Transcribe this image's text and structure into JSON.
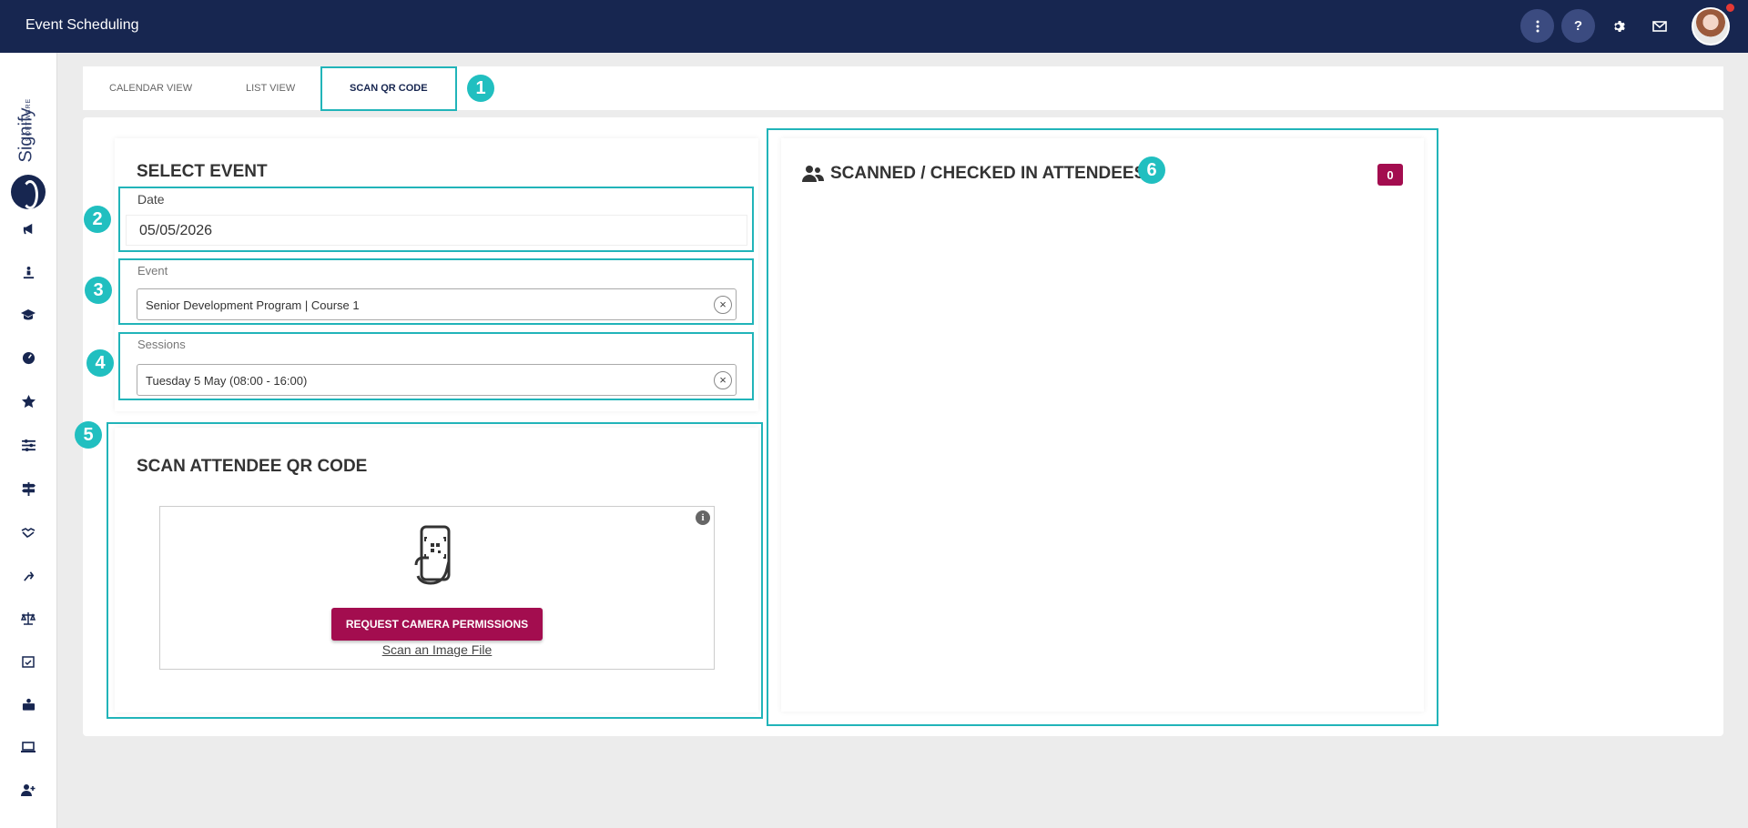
{
  "header": {
    "title": "Event Scheduling"
  },
  "topbar_icons": [
    "more-vert-icon",
    "help-icon",
    "gear-icon",
    "mail-icon",
    "avatar"
  ],
  "logo": {
    "word": "Signify",
    "sub": "SOFTWARE"
  },
  "sidebar": {
    "icons": [
      "megaphone-icon",
      "person-ramp-icon",
      "graduation-cap-icon",
      "gauge-icon",
      "star-icon",
      "sliders-icon",
      "signpost-icon",
      "handshake-icon",
      "route-icon",
      "scales-icon",
      "calendar-check-icon",
      "briefcase-person-icon",
      "laptop-icon",
      "add-user-icon"
    ]
  },
  "tabs": [
    {
      "label": "CALENDAR VIEW",
      "active": false
    },
    {
      "label": "LIST VIEW",
      "active": false
    },
    {
      "label": "SCAN QR CODE",
      "active": true
    }
  ],
  "callouts": [
    "1",
    "2",
    "3",
    "4",
    "5",
    "6"
  ],
  "select_event": {
    "title": "SELECT EVENT",
    "date_label": "Date",
    "date_value": "05/05/2026",
    "event_label": "Event",
    "event_value": "Senior Development Program | Course 1",
    "sessions_label": "Sessions",
    "sessions_value": "Tuesday 5 May (08:00 - 16:00)",
    "clear_symbol": "×"
  },
  "scan": {
    "title": "SCAN ATTENDEE QR CODE",
    "request_button": "REQUEST CAMERA PERMISSIONS",
    "scan_file_link": "Scan an Image File",
    "info_symbol": "i"
  },
  "attendees": {
    "title": "SCANNED / CHECKED IN ATTENDEES",
    "count": "0"
  },
  "colors": {
    "navy": "#172650",
    "accent": "#a30d4f",
    "highlight": "#21b4b9"
  }
}
